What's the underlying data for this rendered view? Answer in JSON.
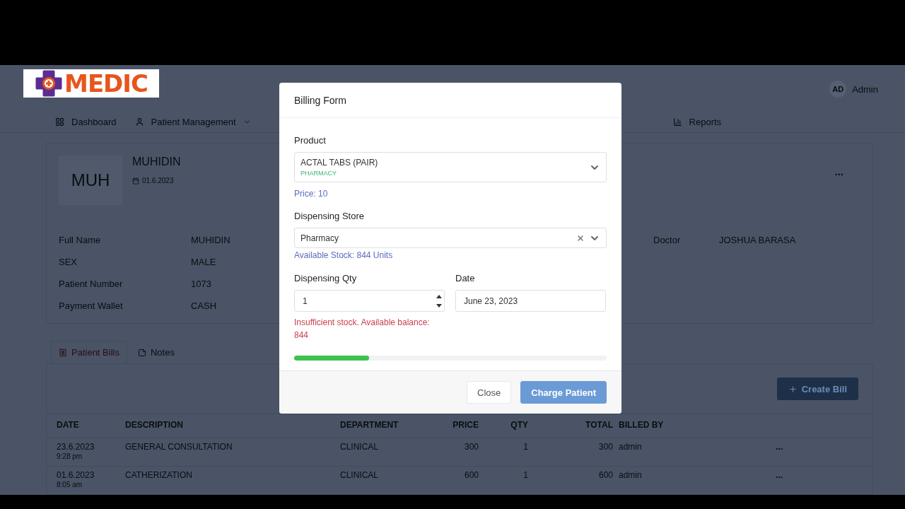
{
  "logo": {
    "text": "MEDIC"
  },
  "user": {
    "initials": "AD",
    "name": "Admin"
  },
  "nav": [
    {
      "label": "Dashboard",
      "kind": "grid",
      "dropdown": false
    },
    {
      "label": "Patient Management",
      "kind": "user",
      "dropdown": true
    },
    {
      "label": "Reports",
      "kind": "chart",
      "dropdown": false
    }
  ],
  "patient": {
    "initials": "MUH",
    "name": "MUHIDIN",
    "date": "01.6.2023",
    "more": "..."
  },
  "details": [
    {
      "label": "Full Name",
      "value": "MUHIDIN"
    },
    {
      "label": "SEX",
      "value": "MALE"
    },
    {
      "label": "Patient Number",
      "value": "1073"
    },
    {
      "label": "Payment Wallet",
      "value": "CASH"
    }
  ],
  "doctor": {
    "label": "Doctor",
    "value": "JOSHUA BARASA"
  },
  "tabs": [
    {
      "label": "Patient Bills",
      "kind": "bill",
      "selected": true
    },
    {
      "label": "Notes",
      "kind": "note",
      "selected": false
    }
  ],
  "create_button": {
    "label": "Create Bill"
  },
  "table": {
    "columns": [
      "DATE",
      "DESCRIPTION",
      "DEPARTMENT",
      "PRICE",
      "QTY",
      "TOTAL",
      "BILLED BY"
    ],
    "rows": [
      {
        "date": "23.6.2023",
        "time": "9:28 pm",
        "description": "GENERAL CONSULTATION",
        "department": "CLINICAL",
        "price": "300",
        "qty": "1",
        "total": "300",
        "billed_by": "admin",
        "actions": "..."
      },
      {
        "date": "01.6.2023",
        "time": "8:05 am",
        "description": "CATHERIZATION",
        "department": "CLINICAL",
        "price": "600",
        "qty": "1",
        "total": "600",
        "billed_by": "admin",
        "actions": "..."
      }
    ]
  },
  "modal": {
    "title": "Billing Form",
    "product": {
      "label": "Product",
      "value": "ACTAL TABS (PAIR)",
      "category": "PHARMACY",
      "price": "Price: 10"
    },
    "store": {
      "label": "Dispensing Store",
      "value": "Pharmacy",
      "clearable": true,
      "stock": "Available Stock: 844 Units"
    },
    "qty": {
      "label": "Dispensing Qty",
      "value": "1",
      "error": "Insufficient stock. Available balance: 844"
    },
    "date": {
      "label": "Date",
      "value": "June 23, 2023"
    },
    "progress": {
      "level": 0.24
    },
    "buttons": [
      {
        "label": "Close",
        "kind": "secondary"
      },
      {
        "label": "Charge Patient",
        "kind": "primary"
      }
    ]
  }
}
